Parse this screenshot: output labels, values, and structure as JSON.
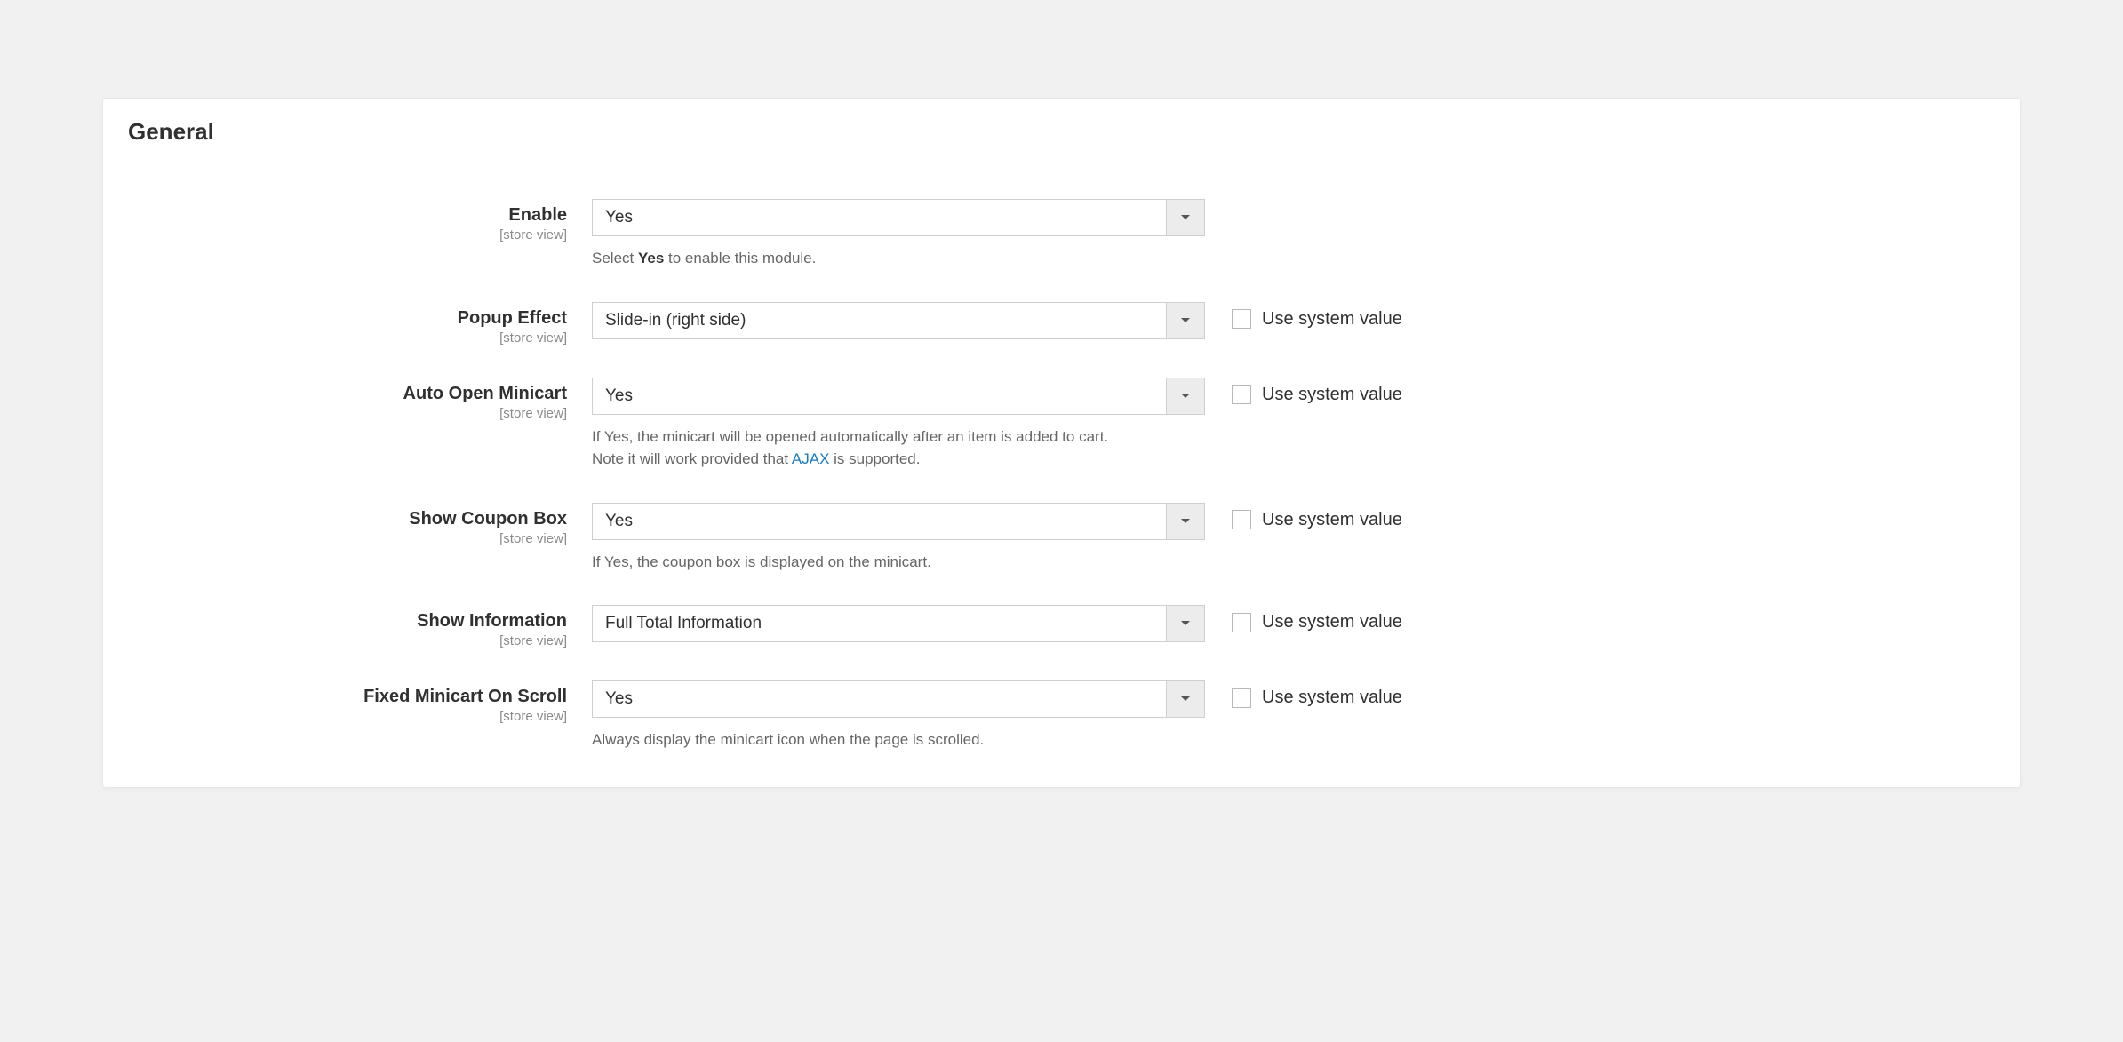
{
  "section_title": "General",
  "scope_label": "[store view]",
  "use_system_value_label": "Use system value",
  "fields": {
    "enable": {
      "label": "Enable",
      "value": "Yes",
      "note_pre": "Select ",
      "note_bold": "Yes",
      "note_post": " to enable this module.",
      "show_sys": false
    },
    "popup_effect": {
      "label": "Popup Effect",
      "value": "Slide-in (right side)",
      "show_sys": true
    },
    "auto_open": {
      "label": "Auto Open Minicart",
      "value": "Yes",
      "note_line1": "If Yes, the minicart will be opened automatically after an item is added to cart.",
      "note_line2_pre": "Note it will work provided that ",
      "note_line2_link": "AJAX",
      "note_line2_post": " is supported.",
      "show_sys": true
    },
    "coupon": {
      "label": "Show Coupon Box",
      "value": "Yes",
      "note": "If Yes, the coupon box is displayed on the minicart.",
      "show_sys": true
    },
    "show_info": {
      "label": "Show Information",
      "value": "Full Total Information",
      "show_sys": true
    },
    "fixed_scroll": {
      "label": "Fixed Minicart On Scroll",
      "value": "Yes",
      "note": "Always display the minicart icon when the page is scrolled.",
      "show_sys": true
    }
  }
}
